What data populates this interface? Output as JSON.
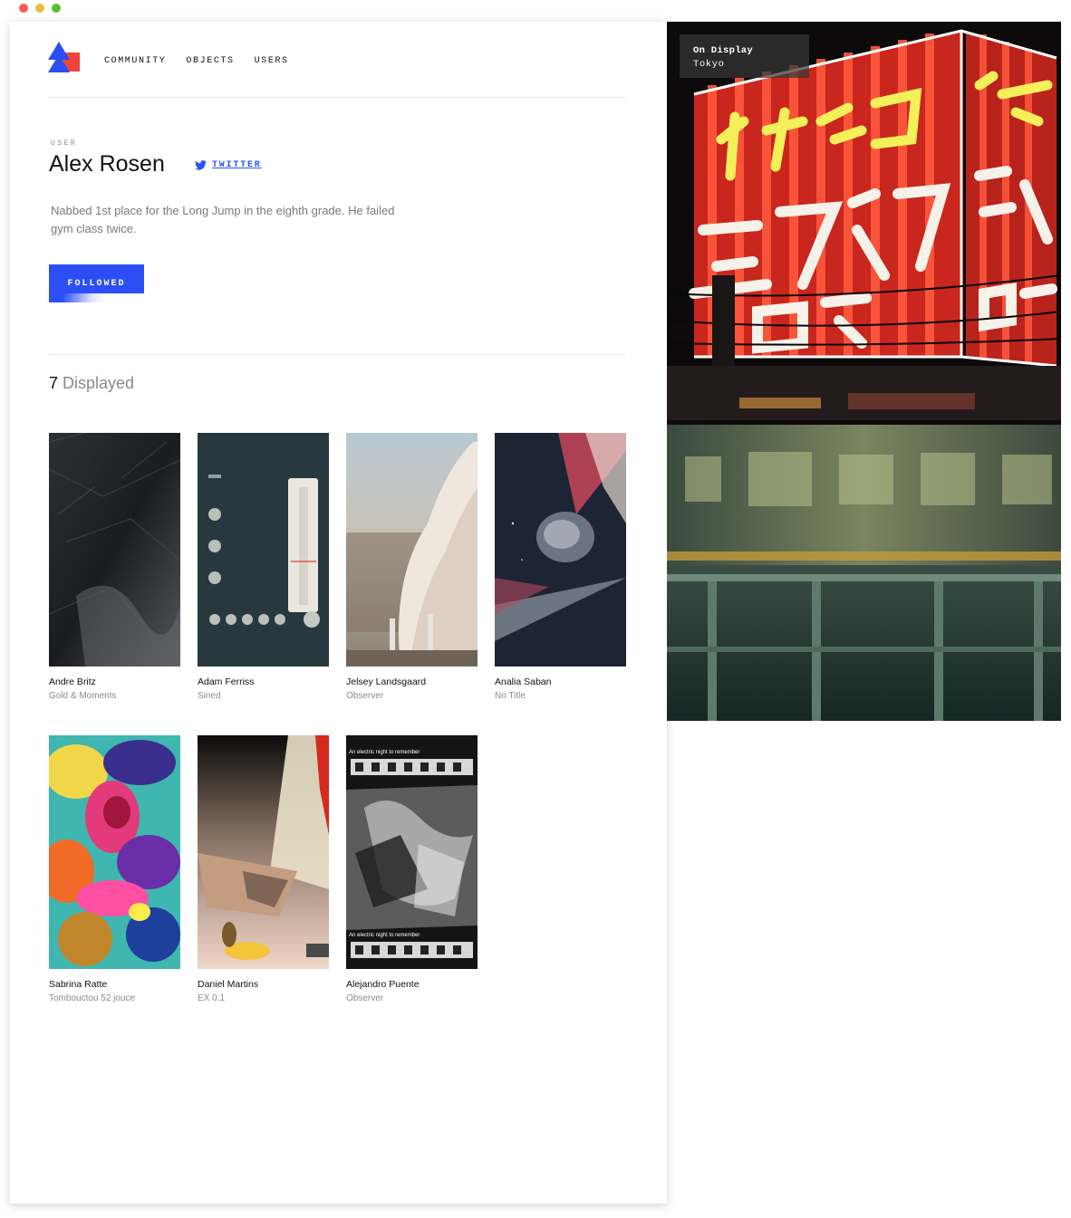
{
  "nav": {
    "items": [
      "COMMUNITY",
      "OBJECTS",
      "USERS"
    ]
  },
  "profile": {
    "section_label": "USER",
    "name": "Alex Rosen",
    "twitter_label": "TWITTER",
    "bio": "Nabbed 1st place for the Long Jump in the eighth grade. He failed gym class twice.",
    "follow_label": "FOLLOWED"
  },
  "gallery": {
    "count": "7",
    "count_label": "Displayed",
    "items": [
      {
        "artist": "Andre Britz",
        "title": "Gold & Moments"
      },
      {
        "artist": "Adam Ferriss",
        "title": "Sined"
      },
      {
        "artist": "Jelsey Landsgaard",
        "title": "Observer"
      },
      {
        "artist": "Analia Saban",
        "title": "No Title"
      },
      {
        "artist": "Sabrina Ratte",
        "title": "Tombouctou 52 jouce"
      },
      {
        "artist": "Daniel Martins",
        "title": "EX 0.1"
      },
      {
        "artist": "Alejandro Puente",
        "title": "Observer",
        "image_caption": "An electric night to remember"
      }
    ]
  },
  "hero": {
    "badge_title": "On Display",
    "badge_location": "Tokyo"
  },
  "colors": {
    "accent": "#2c4ff5",
    "logo_red": "#f0433a",
    "logo_blue": "#2c4ff5"
  }
}
